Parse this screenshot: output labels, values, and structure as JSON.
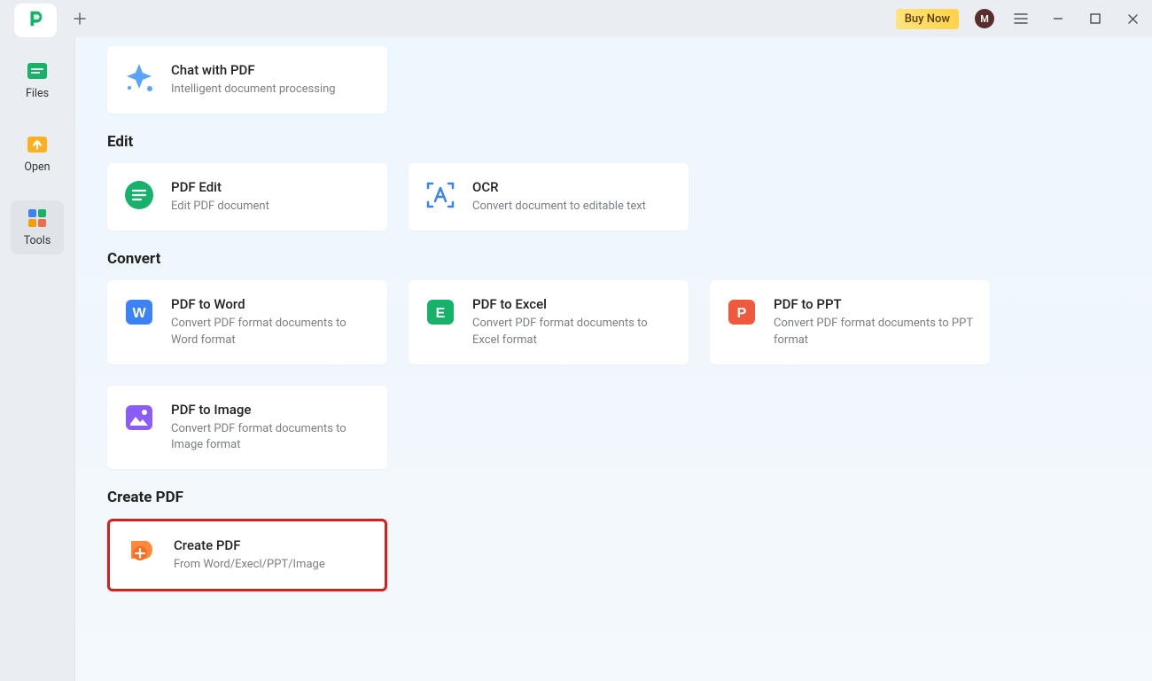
{
  "titlebar": {
    "buy_now": "Buy Now",
    "avatar_letter": "M"
  },
  "sidebar": {
    "items": [
      {
        "label": "Files"
      },
      {
        "label": "Open"
      },
      {
        "label": "Tools"
      }
    ]
  },
  "sections": {
    "ai": {
      "chat_title": "Chat with PDF",
      "chat_desc": "Intelligent document processing"
    },
    "edit": {
      "heading": "Edit",
      "pdfedit_title": "PDF Edit",
      "pdfedit_desc": "Edit PDF document",
      "ocr_title": "OCR",
      "ocr_desc": "Convert document to editable text"
    },
    "convert": {
      "heading": "Convert",
      "word_title": "PDF to Word",
      "word_desc": "Convert PDF format documents to Word format",
      "excel_title": "PDF to Excel",
      "excel_desc": "Convert PDF format documents to Excel format",
      "ppt_title": "PDF to PPT",
      "ppt_desc": "Convert PDF format documents to PPT format",
      "image_title": "PDF to Image",
      "image_desc": "Convert PDF format documents to Image format"
    },
    "create": {
      "heading": "Create PDF",
      "create_title": "Create PDF",
      "create_desc": "From Word/Execl/PPT/Image"
    }
  }
}
